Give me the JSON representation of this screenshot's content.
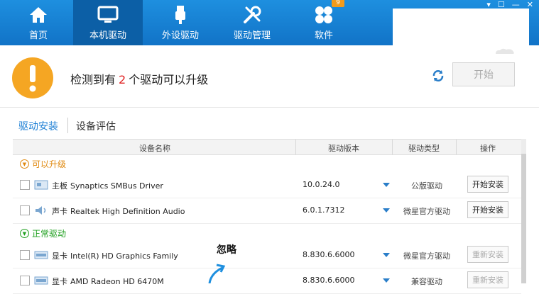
{
  "nav": {
    "items": [
      {
        "label": "首页",
        "icon": "home-icon"
      },
      {
        "label": "本机驱动",
        "icon": "monitor-icon",
        "active": true
      },
      {
        "label": "外设驱动",
        "icon": "usb-icon"
      },
      {
        "label": "驱动管理",
        "icon": "wrench-icon"
      },
      {
        "label": "软件",
        "icon": "apps-icon",
        "badge": "9"
      }
    ]
  },
  "window_controls": {
    "menu": "▾",
    "skin": "☐",
    "minimize": "—",
    "close": "✕"
  },
  "detect": {
    "prefix": "检测到有",
    "count": "2",
    "suffix": "个驱动可以升级",
    "start_label": "开始"
  },
  "tabs": {
    "install": "驱动安装",
    "evaluate": "设备评估"
  },
  "table": {
    "headers": {
      "name": "设备名称",
      "version": "驱动版本",
      "type": "驱动类型",
      "action": "操作"
    },
    "upgradable": {
      "label": "可以升级",
      "rows": [
        {
          "category": "主板",
          "device": "Synaptics SMBus Driver",
          "version": "10.0.24.0",
          "type": "公版驱动",
          "action": "开始安装"
        },
        {
          "category": "声卡",
          "device": "Realtek High Definition Audio",
          "version": "6.0.1.7312",
          "type": "微星官方驱动",
          "action": "开始安装"
        }
      ]
    },
    "normal": {
      "label": "正常驱动",
      "rows": [
        {
          "category": "显卡",
          "device": "Intel(R) HD Graphics Family",
          "version": "8.830.6.6000",
          "type": "微星官方驱动",
          "action": "重新安装"
        },
        {
          "category": "显卡",
          "device": "AMD Radeon HD 6470M",
          "version": "8.830.6.6000",
          "type": "兼容驱动",
          "action": "重新安装"
        }
      ]
    }
  },
  "annotation": {
    "text": "忽略"
  },
  "colors": {
    "topbar": "#1a82d6",
    "accent": "#1b7ed4",
    "warning": "#f5a623",
    "upgrade_group": "#e08a12",
    "normal_group": "#20a020",
    "count": "#e02020"
  }
}
